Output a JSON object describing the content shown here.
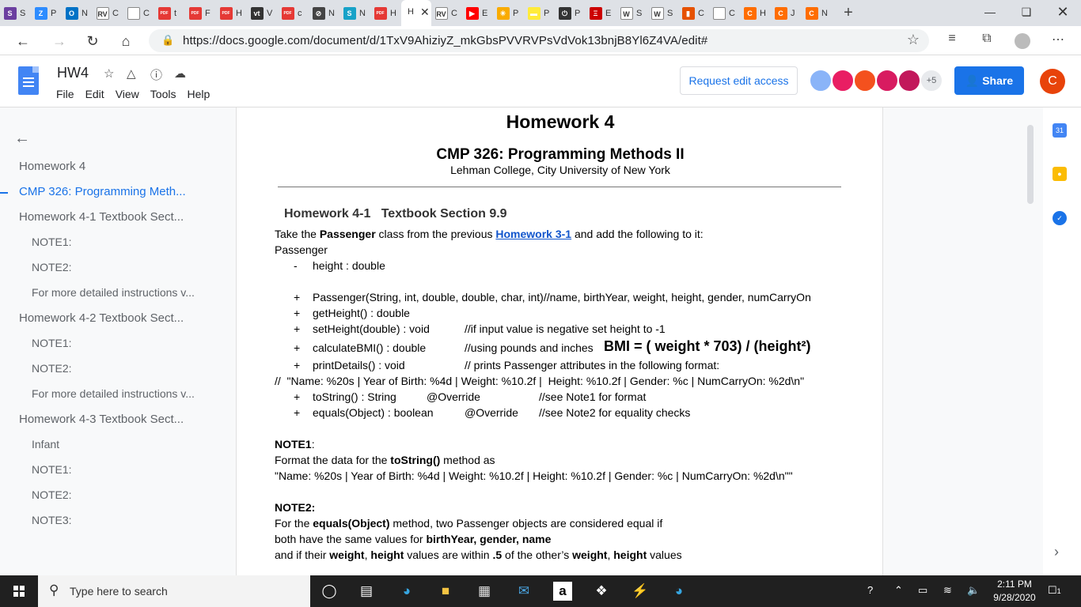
{
  "browser": {
    "tabs": [
      {
        "fav": "S",
        "color": "#6b3fa0",
        "label": "S"
      },
      {
        "fav": "Z",
        "color": "#2d8cff",
        "label": "P"
      },
      {
        "fav": "O",
        "color": "#0072c6",
        "label": "N"
      },
      {
        "fav": "RV",
        "color": "#ffffff",
        "label": "C"
      },
      {
        "fav": "",
        "color": "#ffffff",
        "label": "C"
      },
      {
        "fav": "PDF",
        "color": "#e53935",
        "label": "t"
      },
      {
        "fav": "PDF",
        "color": "#e53935",
        "label": "F"
      },
      {
        "fav": "PDF",
        "color": "#e53935",
        "label": "H"
      },
      {
        "fav": "vt",
        "color": "#333333",
        "label": "V"
      },
      {
        "fav": "PDF",
        "color": "#e53935",
        "label": "c"
      },
      {
        "fav": "⊘",
        "color": "#444444",
        "label": "N"
      },
      {
        "fav": "S",
        "color": "#17a2c8",
        "label": "N"
      },
      {
        "fav": "PDF",
        "color": "#e53935",
        "label": "H"
      },
      {
        "fav": "RV",
        "color": "#ffffff",
        "label": "C"
      },
      {
        "fav": "▶",
        "color": "#ff0000",
        "label": "E"
      },
      {
        "fav": "✳",
        "color": "#f9ab00",
        "label": "P"
      },
      {
        "fav": "▬",
        "color": "#ffeb3b",
        "label": "P"
      },
      {
        "fav": "⏻",
        "color": "#333333",
        "label": "P"
      },
      {
        "fav": "Ξ",
        "color": "#cc0000",
        "label": "E"
      },
      {
        "fav": "W",
        "color": "#ffffff",
        "label": "S"
      },
      {
        "fav": "W",
        "color": "#ffffff",
        "label": "S"
      },
      {
        "fav": "▮",
        "color": "#e65100",
        "label": "C"
      },
      {
        "fav": "",
        "color": "#ffffff",
        "label": "C"
      },
      {
        "fav": "C",
        "color": "#ff6d00",
        "label": "H"
      },
      {
        "fav": "C",
        "color": "#ff6d00",
        "label": "J"
      },
      {
        "fav": "C",
        "color": "#ff6d00",
        "label": "N"
      }
    ],
    "active_tab_label": "H",
    "url": "https://docs.google.com/document/d/1TxV9AhiziyZ_mkGbsPVVRVPsVdVok13bnjB8Yl6Z4VA/edit#"
  },
  "docs": {
    "title": "HW4",
    "menu": [
      "File",
      "Edit",
      "View",
      "Tools",
      "Help"
    ],
    "request_edit": "Request edit access",
    "more_collaborators": "+5",
    "share": "Share",
    "account_initial": "C"
  },
  "outline": [
    {
      "text": "Homework 4",
      "level": 1,
      "active": false
    },
    {
      "text": "CMP 326: Programming Meth...",
      "level": 1,
      "active": true
    },
    {
      "text": "Homework 4-1 Textbook Sect...",
      "level": 1,
      "active": false
    },
    {
      "text": "NOTE1:",
      "level": 2,
      "active": false
    },
    {
      "text": "NOTE2:",
      "level": 2,
      "active": false
    },
    {
      "text": "For more detailed instructions v...",
      "level": 2,
      "active": false
    },
    {
      "text": "Homework 4-2 Textbook Sect...",
      "level": 1,
      "active": false
    },
    {
      "text": "NOTE1:",
      "level": 2,
      "active": false
    },
    {
      "text": "NOTE2:",
      "level": 2,
      "active": false
    },
    {
      "text": "For more detailed instructions v...",
      "level": 2,
      "active": false
    },
    {
      "text": "Homework 4-3 Textbook Sect...",
      "level": 1,
      "active": false
    },
    {
      "text": "Infant",
      "level": 2,
      "active": false
    },
    {
      "text": "NOTE1:",
      "level": 2,
      "active": false
    },
    {
      "text": "NOTE2:",
      "level": 2,
      "active": false
    },
    {
      "text": "NOTE3:",
      "level": 2,
      "active": false
    }
  ],
  "doc": {
    "heading": "Homework 4",
    "course": "CMP 326: Programming Methods II",
    "college": "Lehman College, City University of New York",
    "section_title": "Homework 4-1   Textbook Section 9.9",
    "intro_pre": "Take the ",
    "intro_class": "Passenger",
    "intro_mid": " class from the previous ",
    "intro_link": "Homework 3-1",
    "intro_post": " and add the following to it:",
    "class_name": "Passenger",
    "field_marker": "-",
    "field": "height : double",
    "methods": [
      {
        "sig": "Passenger(String, int, double, double, char, int)//name, birthYear, weight, height, gender, numCarryOn",
        "comment": "",
        "extra": ""
      },
      {
        "sig": "getHeight() : double",
        "comment": "",
        "extra": ""
      },
      {
        "sig": "setHeight(double) : void",
        "comment": "//if input value is negative set height to -1",
        "extra": ""
      },
      {
        "sig": "calculateBMI() : double",
        "comment": "//using pounds and inches",
        "extra": "BMI = ( weight * 703) / (height²)"
      },
      {
        "sig": "printDetails() : void",
        "comment": "// prints Passenger attributes in the following format:",
        "extra": ""
      }
    ],
    "format_line": "//  \"Name: %20s | Year of Birth: %4d | Weight: %10.2f |  Height: %10.2f | Gender: %c | NumCarryOn: %2d\\n\"",
    "methods2": [
      {
        "sig": "toString() : String",
        "override": "@Override",
        "comment": "//see Note1 for format"
      },
      {
        "sig": "equals(Object) : boolean",
        "override": "@Override",
        "comment": "//see Note2 for equality checks"
      }
    ],
    "note1_title": "NOTE1",
    "note1_colon": ":",
    "note1_pre": "Format the data for the ",
    "note1_method": "toString()",
    "note1_post": " method as",
    "note1_format": "\"Name: %20s | Year of Birth: %4d | Weight: %10.2f | Height: %10.2f | Gender: %c | NumCarryOn: %2d\\n\"\"",
    "note2_title": "NOTE2:",
    "note2_l1_pre": "For the ",
    "note2_l1_b": "equals(Object)",
    "note2_l1_post": " method, two Passenger objects are considered equal if",
    "note2_l2_pre": "both have the same values for ",
    "note2_l2_b": "birthYear, gender, name",
    "note2_l3_a": "and if their ",
    "note2_l3_b": "weight",
    "note2_l3_c": ", ",
    "note2_l3_d": "height",
    "note2_l3_e": " values are within ",
    "note2_l3_f": ".5",
    "note2_l3_g": " of the other’s ",
    "note2_l3_h": "weight",
    "note2_l3_i": ", ",
    "note2_l3_j": "height",
    "note2_l3_k": " values"
  },
  "taskbar": {
    "search_placeholder": "Type here to search",
    "time": "2:11 PM",
    "date": "9/28/2020",
    "notification_count": "1"
  }
}
